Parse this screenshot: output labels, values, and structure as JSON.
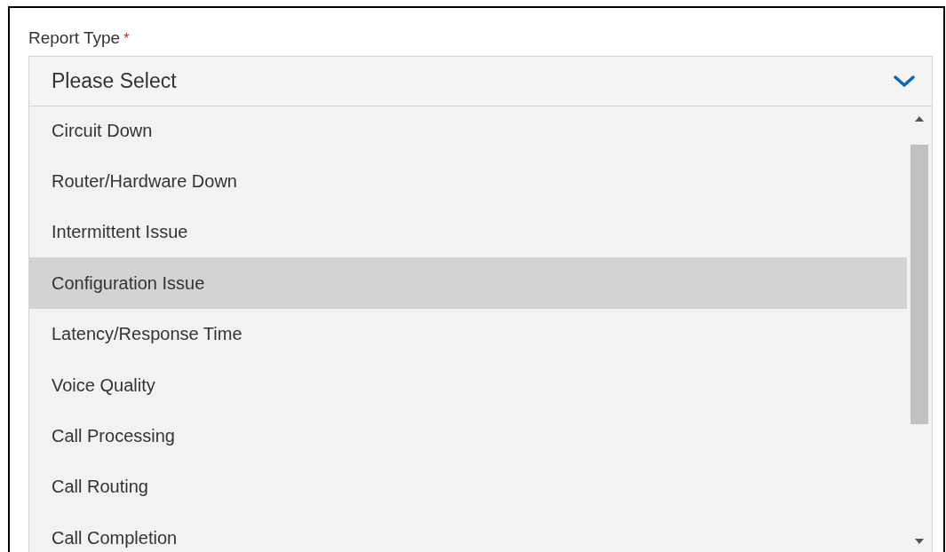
{
  "field": {
    "label": "Report Type",
    "required_mark": "*",
    "placeholder": "Please Select",
    "expanded": true
  },
  "options": [
    {
      "label": "Circuit Down",
      "selected": false
    },
    {
      "label": "Router/Hardware Down",
      "selected": false
    },
    {
      "label": "Intermittent Issue",
      "selected": false
    },
    {
      "label": "Configuration Issue",
      "selected": true
    },
    {
      "label": "Latency/Response Time",
      "selected": false
    },
    {
      "label": "Voice Quality",
      "selected": false
    },
    {
      "label": "Call Processing",
      "selected": false
    },
    {
      "label": "Call Routing",
      "selected": false
    },
    {
      "label": "Call Completion",
      "selected": false
    }
  ]
}
